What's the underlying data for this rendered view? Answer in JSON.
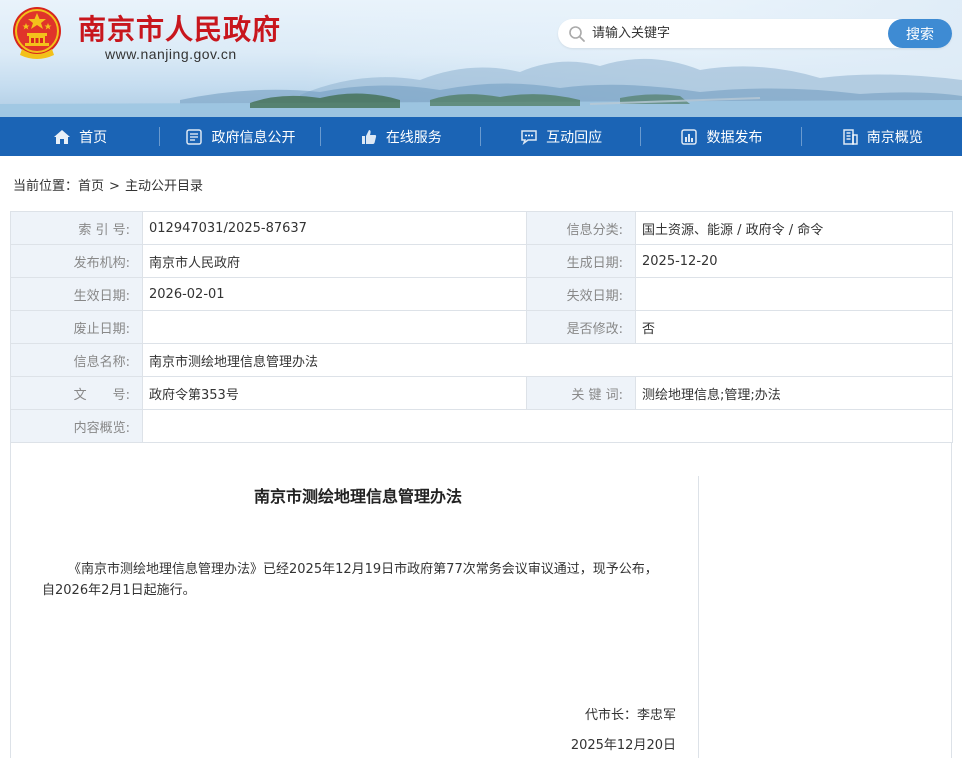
{
  "site": {
    "title": "南京市人民政府",
    "url": "www.nanjing.gov.cn"
  },
  "search": {
    "placeholder": "请输入关键字",
    "button_label": "搜索"
  },
  "nav": {
    "items": [
      {
        "label": "首页",
        "icon": "home-icon"
      },
      {
        "label": "政府信息公开",
        "icon": "document-icon"
      },
      {
        "label": "在线服务",
        "icon": "thumbs-up-icon"
      },
      {
        "label": "互动回应",
        "icon": "chat-icon"
      },
      {
        "label": "数据发布",
        "icon": "bar-chart-icon"
      },
      {
        "label": "南京概览",
        "icon": "building-icon"
      }
    ]
  },
  "breadcrumb": {
    "prefix": "当前位置：",
    "home": "首页",
    "separator": ">",
    "current": "主动公开目录"
  },
  "meta": {
    "index_label": "索 引 号:",
    "index_value": "012947031/2025-87637",
    "category_label": "信息分类:",
    "category_value": "国土资源、能源 / 政府令 / 命令",
    "publisher_label": "发布机构:",
    "publisher_value": "南京市人民政府",
    "created_label": "生成日期:",
    "created_value": "2025-12-20",
    "effective_label": "生效日期:",
    "effective_value": "2026-02-01",
    "expire_label": "失效日期:",
    "expire_value": "",
    "repeal_label": "废止日期:",
    "repeal_value": "",
    "modified_label": "是否修改:",
    "modified_value": "否",
    "name_label": "信息名称:",
    "name_value": "南京市测绘地理信息管理办法",
    "docno_label": "文　　号:",
    "docno_value": "政府令第353号",
    "keywords_label": "关 键 词:",
    "keywords_value": "测绘地理信息;管理;办法",
    "summary_label": "内容概览:",
    "summary_value": ""
  },
  "article": {
    "title": "南京市测绘地理信息管理办法",
    "body": "《南京市测绘地理信息管理办法》已经2025年12月19日市政府第77次常务会议审议通过，现予公布，自2026年2月1日起施行。",
    "signatory": "代市长：李忠军",
    "date": "2025年12月20日"
  },
  "colors": {
    "brand_red": "#c8161d",
    "nav_blue": "#1b64b5",
    "search_button": "#3e8bd3",
    "label_bg": "#eef3f9"
  }
}
